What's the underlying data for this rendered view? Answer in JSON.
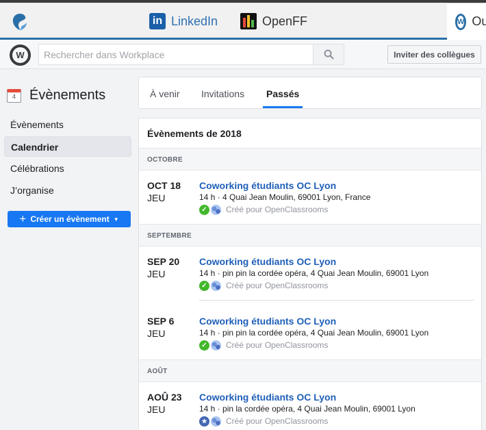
{
  "browser_tabs": [
    {
      "label": "LinkedIn",
      "icon": "linkedin-icon"
    },
    {
      "label": "OpenFF",
      "icon": "openff-icon"
    },
    {
      "label": "Ou",
      "icon": "workplace-icon",
      "active": true
    }
  ],
  "header": {
    "search_placeholder": "Rechercher dans Workplace",
    "invite_label": "Inviter des collègues"
  },
  "sidebar": {
    "title": "Évènements",
    "calendar_day": "4",
    "items": [
      {
        "label": "Évènements"
      },
      {
        "label": "Calendrier",
        "active": true
      },
      {
        "label": "Célébrations"
      },
      {
        "label": "J’organise"
      }
    ],
    "create_label": "Créer un évènement"
  },
  "event_tabs": [
    {
      "label": "À venir"
    },
    {
      "label": "Invitations"
    },
    {
      "label": "Passés",
      "active": true
    }
  ],
  "events_section": {
    "title": "Évènements de 2018",
    "months": [
      {
        "label": "OCTOBRE",
        "events": [
          {
            "date": "OCT 18",
            "day": "JEU",
            "title": "Coworking étudiants OC Lyon",
            "details": "14 h · 4 Quai Jean Moulin, 69001 Lyon, France",
            "meta": "Créé pour OpenClassrooms",
            "status": "going"
          }
        ]
      },
      {
        "label": "SEPTEMBRE",
        "events": [
          {
            "date": "SEP 20",
            "day": "JEU",
            "title": "Coworking étudiants OC Lyon",
            "details": "14 h · pin pin la cordée opéra, 4 Quai Jean Moulin, 69001 Lyon",
            "meta": "Créé pour OpenClassrooms",
            "status": "going"
          },
          {
            "date": "SEP 6",
            "day": "JEU",
            "title": "Coworking étudiants OC Lyon",
            "details": "14 h · pin pin la cordée opéra, 4 Quai Jean Moulin, 69001 Lyon",
            "meta": "Créé pour OpenClassrooms",
            "status": "going"
          }
        ]
      },
      {
        "label": "AOÛT",
        "events": [
          {
            "date": "AOÛ 23",
            "day": "JEU",
            "title": "Coworking étudiants OC Lyon",
            "details": "14 h · pin la cordée opéra, 4 Quai Jean Moulin, 69001 Lyon",
            "meta": "Créé pour OpenClassrooms",
            "status": "interested"
          }
        ]
      }
    ]
  },
  "colors": {
    "accent": "#1877f2",
    "link": "#1f5fb8",
    "going": "#42b72a",
    "interested": "#4267b2"
  }
}
